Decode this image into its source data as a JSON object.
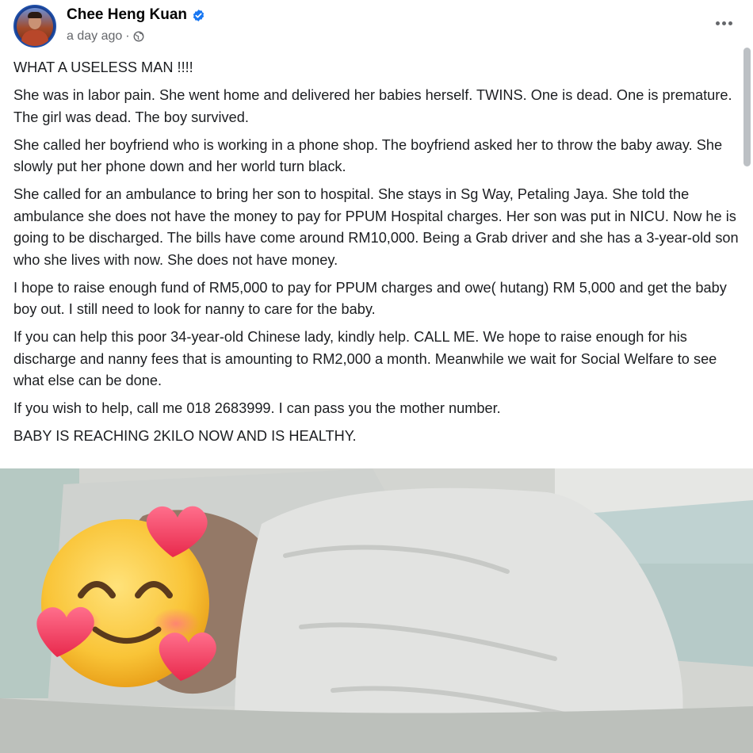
{
  "post": {
    "author": "Chee Heng Kuan",
    "timestamp": "a day ago",
    "separator": "·",
    "icons": {
      "verified": "verified-badge-icon",
      "audience": "globe-icon",
      "more": "more-options-icon"
    },
    "paragraphs": [
      "WHAT A USELESS MAN !!!!",
      "She was in labor pain. She went home and delivered her babies herself. TWINS.  One is dead. One is premature. The girl was dead. The boy survived.",
      "She called her boyfriend who is working in a phone shop. The boyfriend asked her to throw the baby away.  She slowly put her phone down and her world turn black.",
      "She called for an ambulance to bring her son to hospital. She stays in Sg Way, Petaling Jaya. She told the ambulance she does not have the money to pay for PPUM Hospital charges. Her son was put in NICU. Now he is going to be discharged. The bills have come around RM10,000. Being a Grab driver and she has a 3-year-old son who she lives with now.  She does not have money.",
      "I hope to raise enough fund of RM5,000 to pay for PPUM charges and owe( hutang) RM 5,000 and get the baby boy out. I still need to look for nanny to care for the baby.",
      "If you can help this poor 34-year-old Chinese lady, kindly help. CALL ME.  We hope to raise enough for his discharge and nanny fees that is amounting to RM2,000 a month. Meanwhile we wait for Social Welfare to see what else can be done.",
      "If you wish to help, call me 018 2683999. I can pass you the mother number.",
      "BABY IS REACHING 2KILO NOW AND IS HEALTHY."
    ]
  },
  "colors": {
    "verified_blue": "#1877f2",
    "secondary_text": "#65676b",
    "primary_text": "#1c1e21"
  },
  "photo": {
    "overlay_emoji": "smiling-face-with-hearts-icon"
  }
}
